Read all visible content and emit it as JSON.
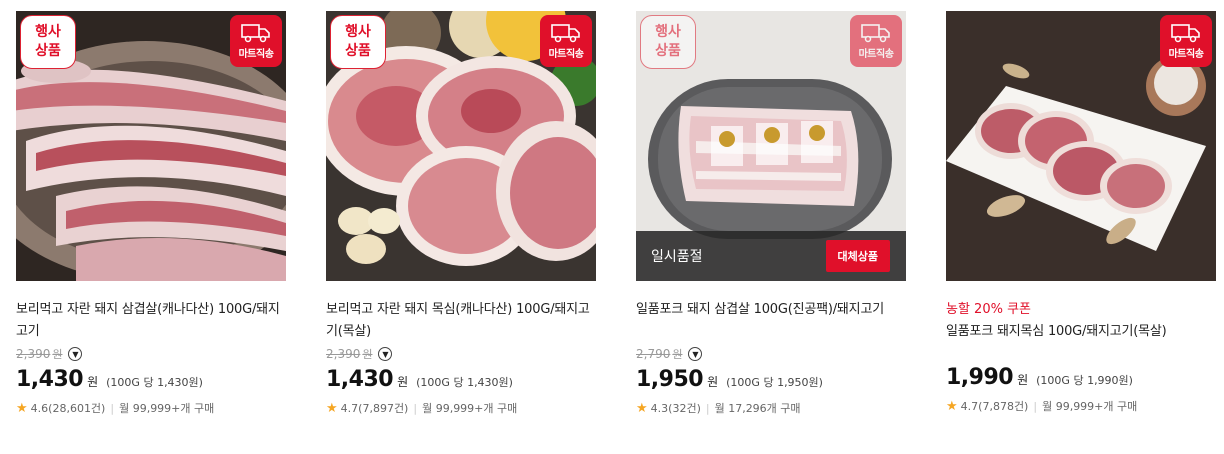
{
  "products": [
    {
      "event_badge": "행사\n상품",
      "mart_badge": "마트직송",
      "title": "보리먹고 자란 돼지 삼겹살(캐나다산) 100G/돼지고기",
      "original_price": "2,390",
      "original_unit": "원",
      "price": "1,430",
      "won": "원",
      "unit_price": "(100G 당 1,430원)",
      "rating": "4.6",
      "review_count": "(28,601건)",
      "monthly": "월 99,999+개 구매"
    },
    {
      "event_badge": "행사\n상품",
      "mart_badge": "마트직송",
      "title": "보리먹고 자란 돼지 목심(캐나다산) 100G/돼지고기(목살)",
      "original_price": "2,390",
      "original_unit": "원",
      "price": "1,430",
      "won": "원",
      "unit_price": "(100G 당 1,430원)",
      "rating": "4.7",
      "review_count": "(7,897건)",
      "monthly": "월 99,999+개 구매"
    },
    {
      "event_badge": "행사\n상품",
      "mart_badge": "마트직송",
      "soldout_label": "일시품절",
      "replace_button": "대체상품",
      "title": "일품포크 돼지 삼겹살 100G(진공팩)/돼지고기",
      "original_price": "2,790",
      "original_unit": "원",
      "price": "1,950",
      "won": "원",
      "unit_price": "(100G 당 1,950원)",
      "rating": "4.3",
      "review_count": "(32건)",
      "monthly": "월 17,296개 구매"
    },
    {
      "mart_badge": "마트직송",
      "promo": "농할 20% 쿠폰",
      "title": "일품포크 돼지목심 100G/돼지고기(목살)",
      "price": "1,990",
      "won": "원",
      "unit_price": "(100G 당 1,990원)",
      "rating": "4.7",
      "review_count": "(7,878건)",
      "monthly": "월 99,999+개 구매"
    }
  ],
  "icons": {
    "info": "chevron-down-icon",
    "star": "star-icon",
    "truck": "truck-icon"
  },
  "colors": {
    "accent": "#e0102a",
    "star": "#f5a623",
    "soldout_bg": "#282828"
  }
}
